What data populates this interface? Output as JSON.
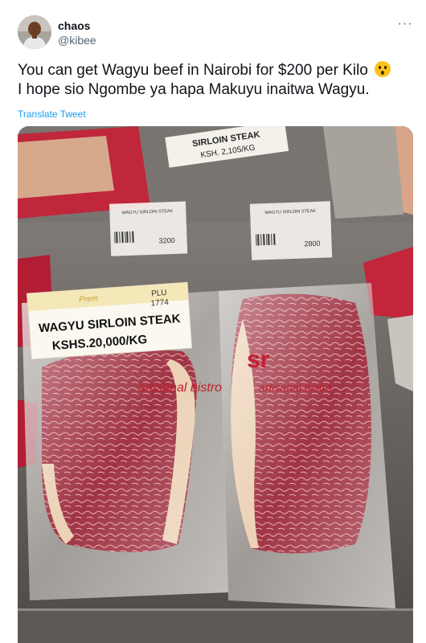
{
  "tweet": {
    "display_name": "chaos",
    "handle": "@kibee",
    "more_icon": "more-horizontal-icon",
    "text_line1": "You can get Wagyu beef in Nairobi for $200 per Kilo",
    "text_line2": "I hope sio Ngombe ya hapa Makuyu inaitwa Wagyu.",
    "emoji": "face-with-open-mouth-emoji",
    "translate_label": "Translate Tweet"
  },
  "photo": {
    "back_sign_line1": "SIRLOIN STEAK",
    "back_sign_line2": "KSH. 2,105/KG",
    "price_label_line1": "PLU",
    "price_label_plu": "1774",
    "price_label_line2": "WAGYU SIRLOIN STEAK",
    "price_label_line3": "KSHS.20,000/KG",
    "brand_fragment": "Prem",
    "left_pack_tag_title": "WAGYU SIRLOIN STEAK",
    "left_pack_tag_price": "3200",
    "right_pack_tag_title": "WAGYU SIRLOIN STEAK",
    "right_pack_tag_price": "2800",
    "bag_print_left": "sr",
    "bag_print_right": "sr",
    "bag_print_script_left": "artisanal bistro",
    "bag_print_script_right": "artisanal bistro"
  },
  "colors": {
    "link": "#1d9bf0",
    "text": "#0f1419",
    "secondary": "#536471",
    "meat_red": "#a3152a",
    "fat_cream": "#e8c9a8"
  }
}
